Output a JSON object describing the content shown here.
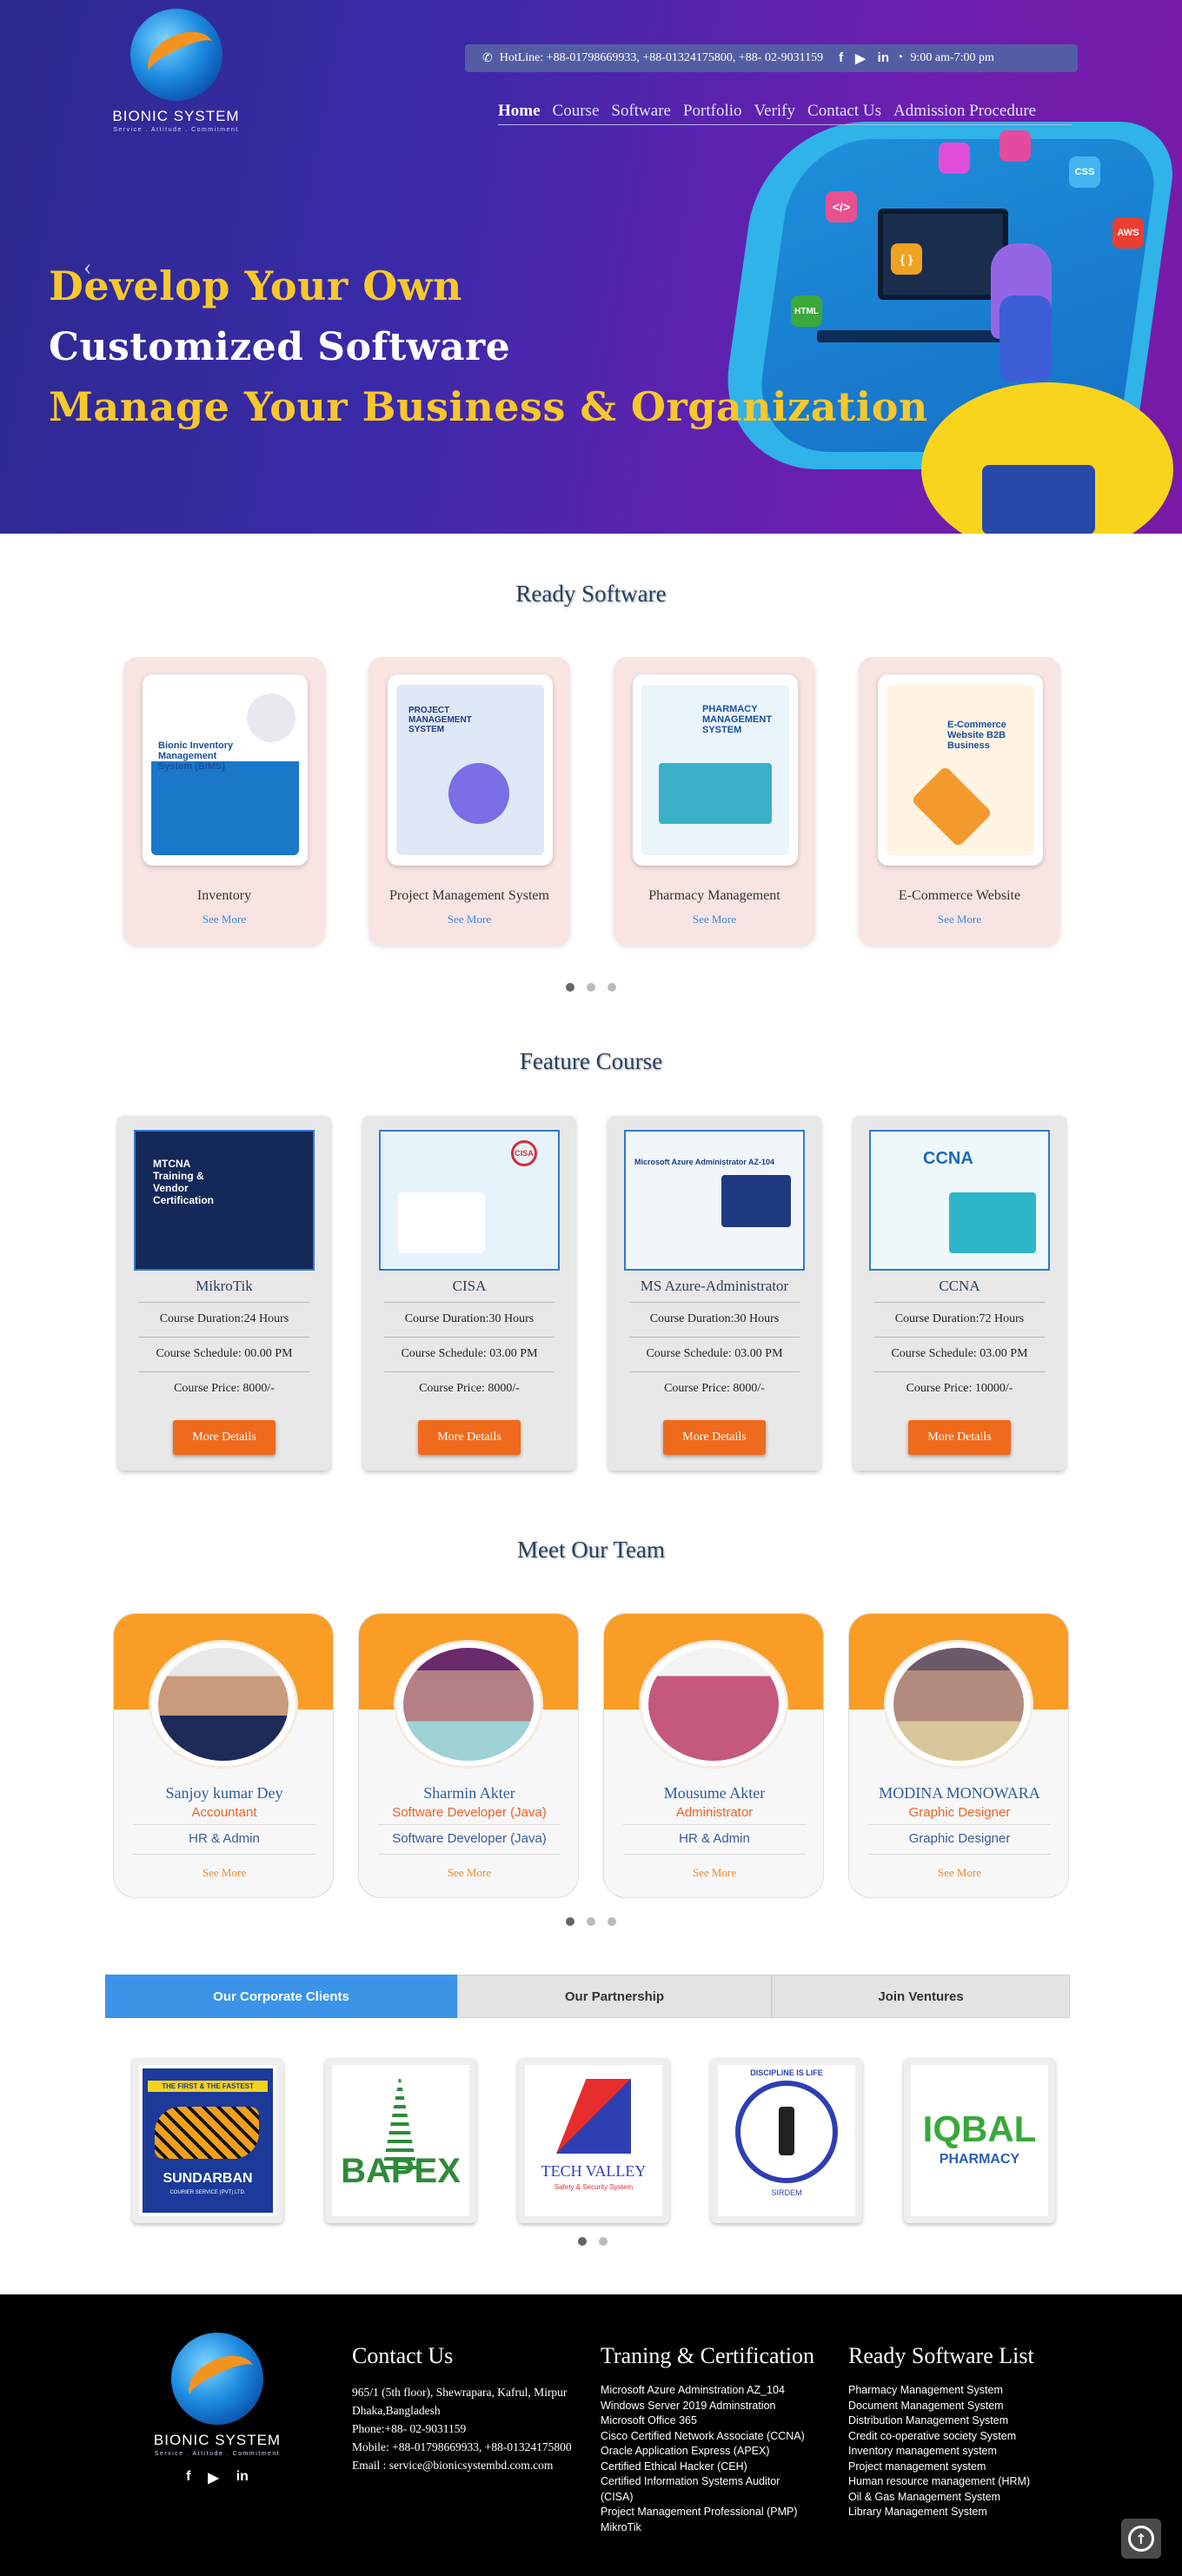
{
  "brand": {
    "name": "BIONIC SYSTEM",
    "tagline": "Service . Attitude . Commitment"
  },
  "topbar": {
    "hotline": "HotLine: +88-01798669933, +88-01324175800, +88- 02-9031159",
    "hours": "9:00 am-7:00 pm",
    "social": [
      "f",
      "▶",
      "in"
    ]
  },
  "nav": [
    "Home",
    "Course",
    "Software",
    "Portfolio",
    "Verify",
    "Contact Us",
    "Admission Procedure"
  ],
  "hero": {
    "line1": "Develop Your  Own",
    "line2": "Customized Software",
    "line3": "Manage Your Business & Organization",
    "prev": "‹",
    "icons": [
      "</>",
      "{ }",
      "AWS",
      "HTML",
      "CSS"
    ]
  },
  "ready_software": {
    "title": "Ready Software",
    "items": [
      {
        "title": "Inventory",
        "link": "See More",
        "poster": "Bionic Inventory Management System (BIMS)",
        "color": "#1a77c9"
      },
      {
        "title": "Project Management System",
        "link": "See More",
        "poster": "PROJECT MANAGEMENT SYSTEM",
        "color": "#dfe8f6"
      },
      {
        "title": "Pharmacy Management",
        "link": "See More",
        "poster": "PHARMACY MANAGEMENT SYSTEM",
        "color": "#eaf4fb"
      },
      {
        "title": "E-Commerce Website",
        "link": "See More",
        "poster": "E-Commerce Website B2B Business",
        "color": "#fff4e3"
      }
    ]
  },
  "feature_course": {
    "title": "Feature Course",
    "button": "More Details",
    "items": [
      {
        "name": "MikroTik",
        "duration": "Course Duration:24 Hours",
        "schedule": "Course Schedule: 00.00 PM",
        "price": "Course Price: 8000/-",
        "poster": "MTCNA Training & Vendor Certification",
        "bg": "#14285a"
      },
      {
        "name": "CISA",
        "duration": "Course Duration:30 Hours",
        "schedule": "Course Schedule: 03.00 PM",
        "price": "Course Price: 8000/-",
        "poster": "CISA",
        "bg": "#e7f3fb"
      },
      {
        "name": "MS Azure-Administrator",
        "duration": "Course Duration:30 Hours",
        "schedule": "Course Schedule: 03.00 PM",
        "price": "Course Price: 8000/-",
        "poster": "Microsoft Azure Administrator AZ-104",
        "bg": "#f1f6fb"
      },
      {
        "name": "CCNA",
        "duration": "Course Duration:72 Hours",
        "schedule": "Course Schedule: 03.00 PM",
        "price": "Course Price: 10000/-",
        "poster": "CCNA",
        "bg": "#eef8fb"
      }
    ]
  },
  "team": {
    "title": "Meet Our Team",
    "link": "See More",
    "members": [
      {
        "name": "Sanjoy kumar Dey",
        "role": "Accountant",
        "dept": "HR & Admin",
        "shade": "#c99a7b"
      },
      {
        "name": "Sharmin Akter",
        "role": "Software Developer (Java)",
        "dept": "Software Developer (Java)",
        "shade": "#b57f86"
      },
      {
        "name": "Mousume Akter",
        "role": "Administrator",
        "dept": "HR & Admin",
        "shade": "#c4597c"
      },
      {
        "name": "MODINA MONOWARA",
        "role": "Graphic Designer",
        "dept": "Graphic Designer",
        "shade": "#b38b7e"
      }
    ]
  },
  "clients": {
    "tabs": [
      "Our Corporate Clients",
      "Our Partnership",
      "Join Ventures"
    ],
    "logos": [
      {
        "name": "SUNDARBAN",
        "top": "THE FIRST & THE FASTEST",
        "sub": "COURIER SERVICE (PVT) LTD."
      },
      {
        "name": "BAPEX"
      },
      {
        "name": "TECH VALLEY",
        "sub": "Safety & Security System"
      },
      {
        "name": "DISCIPLINE IS LIFE",
        "sub": "SIRDEM"
      },
      {
        "name": "IQBAL",
        "sub": "PHARMACY"
      }
    ]
  },
  "footer": {
    "contact": {
      "title": "Contact Us",
      "lines": [
        "965/1 (5th floor), Shewrapara, Kafrul, Mirpur",
        "Dhaka,Bangladesh",
        "Phone:+88- 02-9031159",
        "Mobile: +88-01798669933, +88-01324175800",
        "Email : service@bionicsystembd.com.com"
      ]
    },
    "training": {
      "title": "Traning & Certification",
      "items": [
        "Microsoft Azure Adminstration AZ_104",
        "Windows Server 2019 Adminstration",
        "Microsoft Office 365",
        "Cisco Certified Network Associate (CCNA)",
        "Oracle Application Express (APEX)",
        "Certified Ethical Hacker (CEH)",
        "Certified Information Systems Auditor",
        "(CISA)",
        "Project Management Professional (PMP)",
        "MikroTik"
      ]
    },
    "software": {
      "title": "Ready Software List",
      "items": [
        "Pharmacy Management System",
        "Document Management System",
        "Distribution Management System",
        "Credit co-operative society System",
        "Inventory management system",
        "Project management system",
        "Human resource management (HRM)",
        "Oil & Gas Management System",
        "Library Management System"
      ]
    },
    "social": [
      "f",
      "▶",
      "in"
    ]
  },
  "colors": {
    "accent": "#f06a1d",
    "brand_blue": "#3b94e8",
    "team_orange": "#f99d26",
    "headline_yellow": "#f7c82c"
  }
}
